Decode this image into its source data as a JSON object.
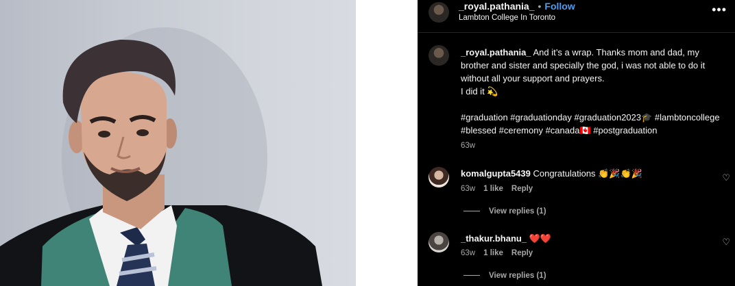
{
  "post": {
    "owner": "_royal.pathania_",
    "separator": "•",
    "follow_label": "Follow",
    "location": "Lambton College In Toronto",
    "more_icon": "more-horizontal-icon",
    "caption_username": "_royal.pathania_",
    "caption_text": "And it’s a wrap. Thanks mom and dad, my brother and sister and specially the god, i was not able to do it without all your support and prayers.",
    "caption_line2": "I did it 💫",
    "hashtags": "#graduation #graduationday #graduation2023🎓 #lambtoncollege #blessed #ceremony #canada🇨🇦 #postgraduation",
    "caption_time": "63w"
  },
  "comments": [
    {
      "username": "komalgupta5439",
      "text": "Congratulations 👏🎉👏🎉",
      "time": "63w",
      "likes": "1 like",
      "reply_label": "Reply",
      "view_replies": "View replies (1)"
    },
    {
      "username": "_thakur.bhanu_",
      "text": "❤️❤️",
      "time": "63w",
      "likes": "1 like",
      "reply_label": "Reply",
      "view_replies": "View replies (1)"
    }
  ],
  "icons": {
    "like": "heart-icon",
    "more": "more-horizontal-icon"
  },
  "colors": {
    "panel_bg": "#000000",
    "follow": "#4c9ef5",
    "muted": "#a8a8a8",
    "heart": "#ff3040"
  }
}
